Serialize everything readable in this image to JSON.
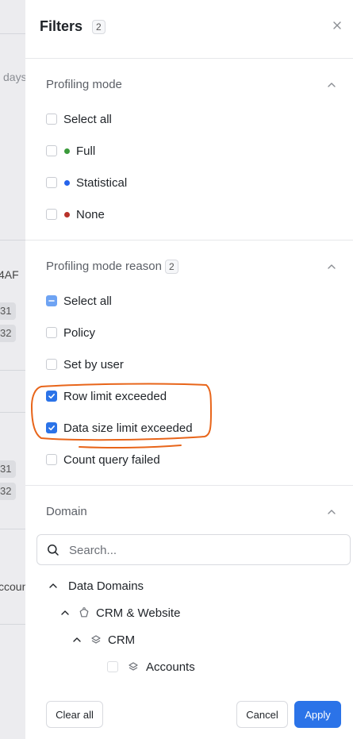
{
  "background": {
    "fragments": [
      "days",
      "4AF",
      "31",
      "32",
      "31",
      "32",
      "ccoun"
    ]
  },
  "drawer": {
    "title": "Filters",
    "active_count": "2",
    "close_icon": "close-icon"
  },
  "profiling_mode": {
    "heading": "Profiling mode",
    "options": [
      {
        "label": "Select all",
        "checked": false
      },
      {
        "label": "Full",
        "dot_color": "#3a9a3a",
        "checked": false
      },
      {
        "label": "Statistical",
        "dot_color": "#2563eb",
        "checked": false
      },
      {
        "label": "None",
        "dot_color": "#b8322a",
        "checked": false
      }
    ]
  },
  "profiling_reason": {
    "heading": "Profiling mode reason",
    "count": "2",
    "options": [
      {
        "label": "Select all",
        "state": "partial"
      },
      {
        "label": "Policy",
        "state": "unchecked"
      },
      {
        "label": "Set by user",
        "state": "unchecked"
      },
      {
        "label": "Row limit exceeded",
        "state": "checked"
      },
      {
        "label": "Data size limit exceeded",
        "state": "checked"
      },
      {
        "label": "Count query failed",
        "state": "unchecked"
      }
    ]
  },
  "domain": {
    "heading": "Domain",
    "search_placeholder": "Search...",
    "tree": [
      {
        "label": "Data Domains",
        "level": 0,
        "expanded": true,
        "icon": ""
      },
      {
        "label": "CRM & Website",
        "level": 1,
        "expanded": true,
        "icon": "domain-icon"
      },
      {
        "label": "CRM",
        "level": 2,
        "expanded": true,
        "icon": "layers-icon"
      },
      {
        "label": "Accounts",
        "level": 3,
        "expanded": false,
        "icon": "layers-icon"
      }
    ]
  },
  "footer": {
    "clear_label": "Clear all",
    "cancel_label": "Cancel",
    "apply_label": "Apply"
  },
  "colors": {
    "accent": "#2b73e8",
    "annotation": "#e8651a"
  }
}
